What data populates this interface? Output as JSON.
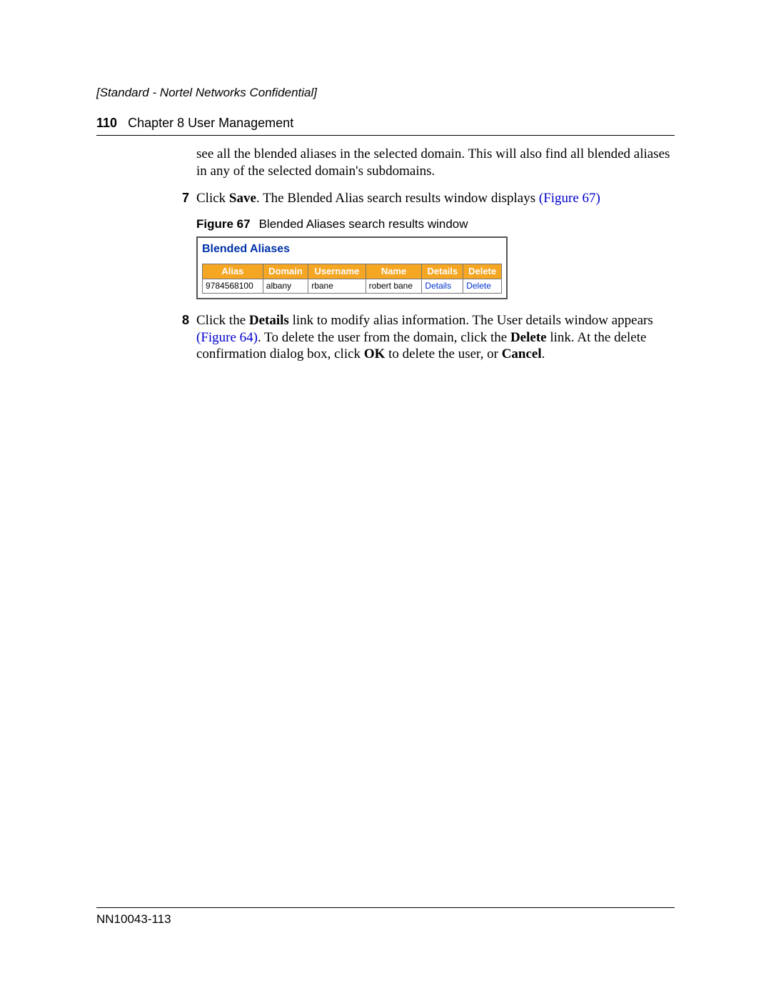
{
  "confidential": "[Standard - Nortel Networks Confidential]",
  "header": {
    "page": "110",
    "chapter": "Chapter 8  User Management"
  },
  "intro_para": "see all the blended aliases in the selected domain. This will also find all blended aliases in any of the selected domain's subdomains.",
  "step7": {
    "num": "7",
    "pre": "Click ",
    "b1": "Save",
    "mid": ". The Blended Alias search results window displays ",
    "xref": "(Figure 67)"
  },
  "fig": {
    "label": "Figure 67",
    "caption": "Blended Aliases search results window"
  },
  "shot": {
    "title": "Blended Aliases",
    "headers": [
      "Alias",
      "Domain",
      "Username",
      "Name",
      "Details",
      "Delete"
    ],
    "row": {
      "alias": "9784568100",
      "domain": "albany",
      "username": "rbane",
      "name": "robert bane",
      "details": "Details",
      "delete": "Delete"
    }
  },
  "step8": {
    "num": "8",
    "a": "Click the ",
    "b1": "Details",
    "b": " link to modify alias information. The User details window appears ",
    "xref": "(Figure 64)",
    "c": ". To delete the user from the domain, click the ",
    "b2": "Delete",
    "d": " link. At the delete confirmation dialog box, click ",
    "b3": "OK",
    "e": " to delete the user, or ",
    "b4": "Cancel",
    "f": "."
  },
  "footer": "NN10043-113"
}
